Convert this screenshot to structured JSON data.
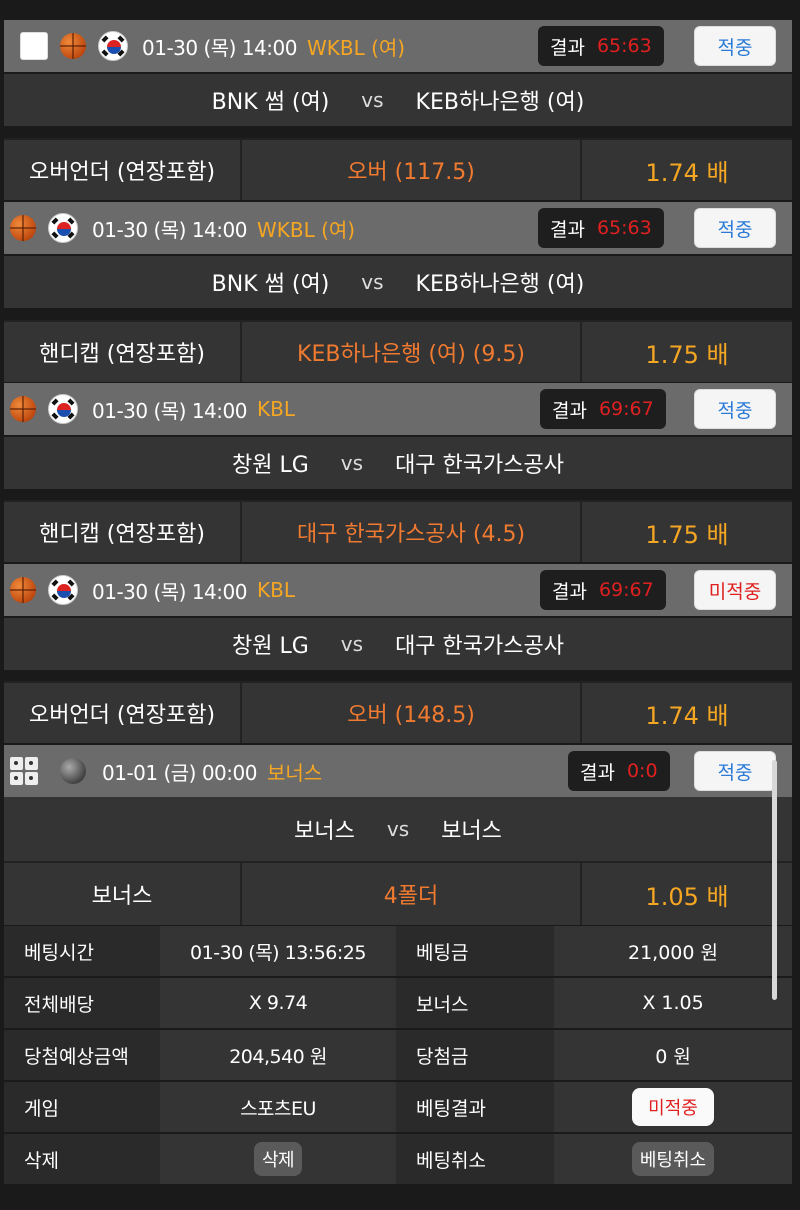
{
  "bets": [
    {
      "date": "01-30 (목) 14:00",
      "league": "WKBL (여)",
      "result_label": "결과",
      "result_score": "65:63",
      "status": "적중",
      "home": "BNK 썸 (여)",
      "vs": "vs",
      "away": "KEB하나은행 (여)",
      "market": "오버언더 (연장포함)",
      "pick": "오버 (117.5)",
      "odds": "1.74 배"
    },
    {
      "date": "01-30 (목) 14:00",
      "league": "WKBL (여)",
      "result_label": "결과",
      "result_score": "65:63",
      "status": "적중",
      "home": "BNK 썸 (여)",
      "vs": "vs",
      "away": "KEB하나은행 (여)",
      "market": "핸디캡 (연장포함)",
      "pick": "KEB하나은행 (여) (9.5)",
      "odds": "1.75 배"
    },
    {
      "date": "01-30 (목) 14:00",
      "league": "KBL",
      "result_label": "결과",
      "result_score": "69:67",
      "status": "적중",
      "home": "창원 LG",
      "vs": "vs",
      "away": "대구 한국가스공사",
      "market": "핸디캡 (연장포함)",
      "pick": "대구 한국가스공사 (4.5)",
      "odds": "1.75 배"
    },
    {
      "date": "01-30 (목) 14:00",
      "league": "KBL",
      "result_label": "결과",
      "result_score": "69:67",
      "status": "미적중",
      "home": "창원 LG",
      "vs": "vs",
      "away": "대구 한국가스공사",
      "market": "오버언더 (연장포함)",
      "pick": "오버 (148.5)",
      "odds": "1.74 배"
    },
    {
      "date": "01-01 (금) 00:00",
      "league": "보너스",
      "result_label": "결과",
      "result_score": "0:0",
      "status": "적중",
      "home": "보너스",
      "vs": "vs",
      "away": "보너스",
      "market": "보너스",
      "pick": "4폴더",
      "odds": "1.05 배"
    }
  ],
  "summary": {
    "bet_time_label": "베팅시간",
    "bet_time": "01-30 (목) 13:56:25",
    "bet_amount_label": "베팅금",
    "bet_amount": "21,000 원",
    "total_odds_label": "전체배당",
    "total_odds": "X 9.74",
    "bonus_label": "보너스",
    "bonus": "X 1.05",
    "expected_label": "당첨예상금액",
    "expected": "204,540 원",
    "winnings_label": "당첨금",
    "winnings": "0 원",
    "game_label": "게임",
    "game": "스포츠EU",
    "bet_result_label": "베팅결과",
    "bet_result": "미적중",
    "delete_label": "삭제",
    "delete_button": "삭제",
    "cancel_label": "베팅취소",
    "cancel_button": "베팅취소"
  },
  "colors": {
    "league": "#f5a623",
    "pick": "#f07a30",
    "odds": "#f5a623",
    "score": "#e02020",
    "win": "#2a7ad8",
    "lose": "#e02020"
  }
}
